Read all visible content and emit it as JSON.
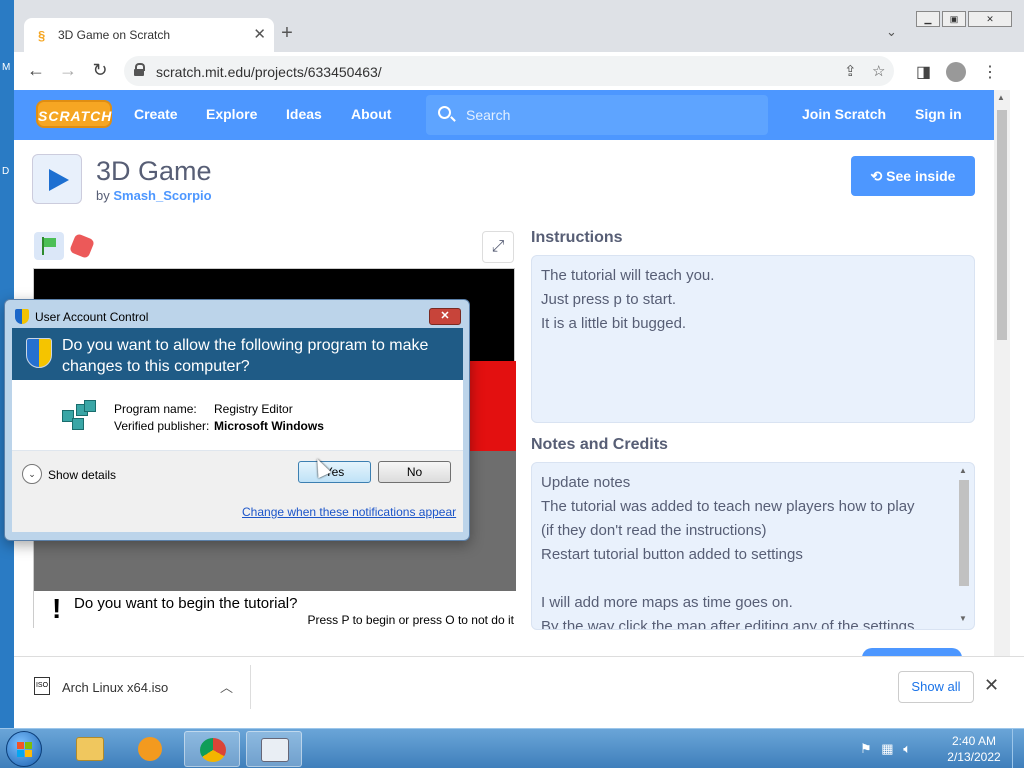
{
  "browser": {
    "tab_title": "3D Game on Scratch",
    "tab_close": "✕",
    "new_tab": "+",
    "url": "scratch.mit.edu/projects/633450463/"
  },
  "scratch": {
    "logo": "SCRATCH",
    "nav": [
      "Create",
      "Explore",
      "Ideas",
      "About"
    ],
    "search_placeholder": "Search",
    "join": "Join Scratch",
    "signin": "Sign in",
    "project_title": "3D Game",
    "by_label": "by",
    "author": "Smash_Scorpio",
    "see_inside": "See inside",
    "instructions_title": "Instructions",
    "instructions": [
      "The tutorial will teach you.",
      "Just press p to start.",
      "It is a little bit bugged."
    ],
    "notes_title": "Notes and Credits",
    "notes": [
      "Update notes",
      "The tutorial was added to teach new players how to play",
      "(if they don't read the instructions)",
      "Restart tutorial button added to settings",
      "",
      "I will add more maps as time goes on.",
      "By the way click the map after editing any of the settings"
    ],
    "stage_question": "Do you want to begin the tutorial?",
    "stage_hint": "Press P to begin or press O to not do it"
  },
  "uac": {
    "title": "User Account Control",
    "question": "Do you want to allow the following program to make changes to this computer?",
    "program_label": "Program name:",
    "program_value": "Registry Editor",
    "publisher_label": "Verified publisher:",
    "publisher_value": "Microsoft Windows",
    "show_details": "Show details",
    "yes": "Yes",
    "no": "No",
    "link": "Change when these notifications appear"
  },
  "downloads": {
    "file": "Arch Linux x64.iso",
    "icon_text": "ISO",
    "show_all": "Show all"
  },
  "taskbar": {
    "time": "2:40 AM",
    "date": "2/13/2022"
  },
  "colors": {
    "scratch_blue": "#4d97ff",
    "uac_header": "#1f5b86",
    "stage_red": "#e31010"
  }
}
